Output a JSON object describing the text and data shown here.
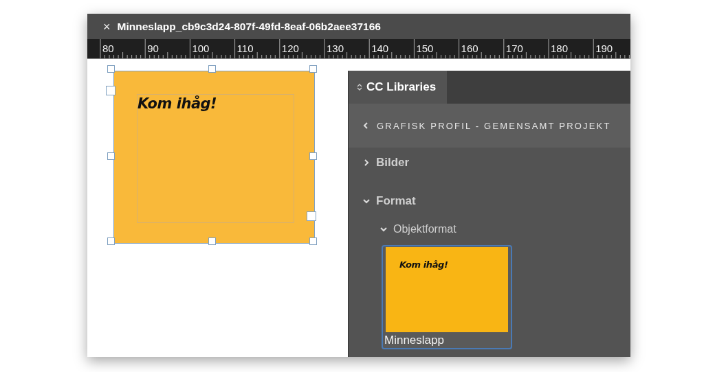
{
  "document_tab": {
    "close": "×",
    "title": "Minneslapp_cb9c3d24-807f-49fd-8eaf-06b2aee37166"
  },
  "ruler": {
    "labels": [
      "80",
      "90",
      "100",
      "110",
      "120",
      "130",
      "140",
      "150",
      "160",
      "170",
      "180",
      "190"
    ]
  },
  "canvas": {
    "note": {
      "text": "Kom ihåg!",
      "selected": true
    }
  },
  "panel": {
    "tab": {
      "label": "CC Libraries",
      "selected": true
    },
    "library": {
      "title": "GRAFISK PROFIL - GEMENSAMT PROJEKT"
    },
    "sections": [
      {
        "label": "Bilder",
        "expanded": false
      },
      {
        "label": "Format",
        "expanded": true,
        "children": [
          {
            "label": "Objektformat",
            "expanded": true,
            "items": [
              {
                "name": "Minneslapp",
                "preview_text": "Kom ihåg!",
                "selected": true
              }
            ]
          }
        ]
      }
    ]
  }
}
